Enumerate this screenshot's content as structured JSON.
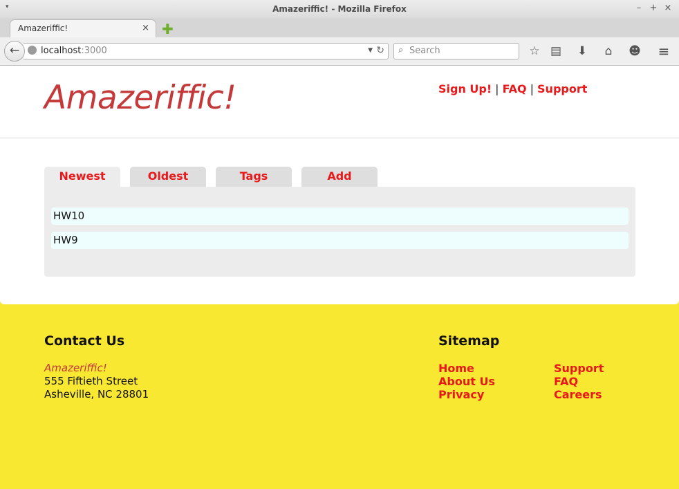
{
  "window": {
    "title": "Amazeriffic! - Mozilla Firefox",
    "menu_glyph": "▾",
    "controls": {
      "minimize": "–",
      "maximize": "+",
      "close": "×"
    }
  },
  "browser": {
    "tab_title": "Amazeriffic!",
    "tab_close": "×",
    "new_tab": "✚",
    "back": "←",
    "url_host": "localhost",
    "url_port": ":3000",
    "url_dropdown": "▼",
    "reload": "↻",
    "search_placeholder": "Search",
    "search_icon": "⌕",
    "toolbar_icons": [
      "bookmark-star-icon",
      "reading-list-icon",
      "download-icon",
      "home-icon",
      "chat-icon",
      "menu-icon"
    ],
    "toolbar_glyphs": {
      "bookmark": "☆",
      "reading": "▤",
      "download": "⬇",
      "home": "⌂",
      "chat": "☻",
      "menu": "≡"
    }
  },
  "site": {
    "logo": "Amazeriffic!",
    "nav": {
      "signup": "Sign Up!",
      "faq": "FAQ",
      "support": "Support",
      "separator": "|"
    },
    "tabs": [
      {
        "label": "Newest",
        "active": true
      },
      {
        "label": "Oldest",
        "active": false
      },
      {
        "label": "Tags",
        "active": false
      },
      {
        "label": "Add",
        "active": false
      }
    ],
    "items": [
      "HW10",
      "HW9"
    ]
  },
  "footer": {
    "contact_heading": "Contact Us",
    "contact_brand": "Amazeriffic!",
    "address_line1": "555 Fiftieth Street",
    "address_line2": "Asheville, NC 28801",
    "sitemap_heading": "Sitemap",
    "sitemap_col1": [
      "Home",
      "About Us",
      "Privacy"
    ],
    "sitemap_col2": [
      "Support",
      "FAQ",
      "Careers"
    ]
  },
  "colors": {
    "accent_red": "#e8191b",
    "logo_red": "#c4393a",
    "footer_yellow": "#f9e832",
    "item_bg": "#eefefe"
  }
}
